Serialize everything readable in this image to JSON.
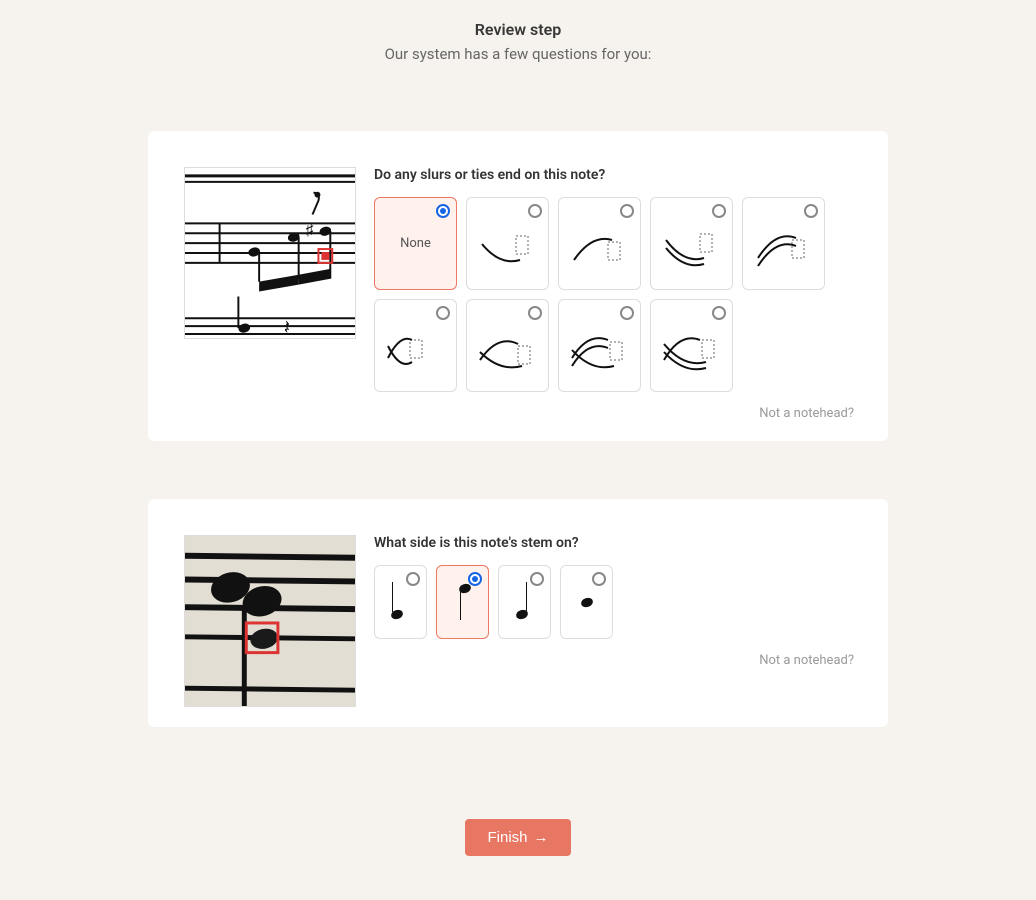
{
  "header": {
    "title": "Review step",
    "subtitle": "Our system has a few questions for you:"
  },
  "question1": {
    "prompt": "Do any slurs or ties end on this note?",
    "options": {
      "none_label": "None"
    },
    "not_notehead": "Not a notehead?",
    "selected_index": 0
  },
  "question2": {
    "prompt": "What side is this note's stem on?",
    "not_notehead": "Not a notehead?",
    "selected_index": 1
  },
  "finish": {
    "label": "Finish"
  },
  "colors": {
    "accent": "#e77663",
    "select_border": "#ed7864",
    "radio_active": "#1565e6"
  }
}
